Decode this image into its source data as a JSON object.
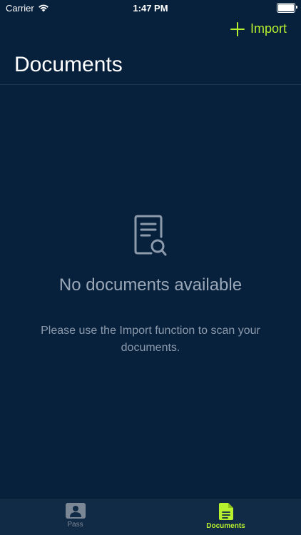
{
  "status_bar": {
    "carrier": "Carrier",
    "time": "1:47 PM"
  },
  "nav": {
    "import_label": "Import",
    "title": "Documents"
  },
  "empty_state": {
    "icon": "document-search-icon",
    "title": "No documents available",
    "description": "Please use the Import function to scan your documents."
  },
  "tab_bar": {
    "items": [
      {
        "label": "Pass",
        "icon": "person-card-icon",
        "selected": false
      },
      {
        "label": "Documents",
        "icon": "document-icon",
        "selected": true
      }
    ]
  },
  "colors": {
    "background": "#07213d",
    "accent": "#b7f02e",
    "muted_text": "#9aa8b8",
    "tab_bar": "#112a45"
  }
}
